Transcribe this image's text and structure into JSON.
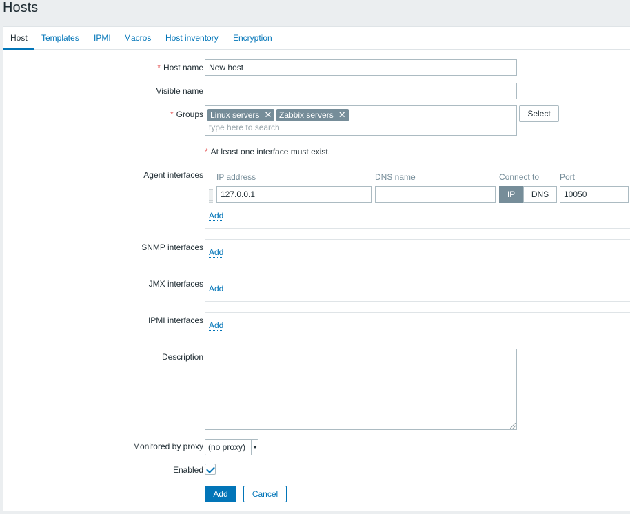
{
  "page": {
    "title": "Hosts"
  },
  "tabs": [
    {
      "label": "Host",
      "active": true
    },
    {
      "label": "Templates"
    },
    {
      "label": "IPMI"
    },
    {
      "label": "Macros"
    },
    {
      "label": "Host inventory"
    },
    {
      "label": "Encryption"
    }
  ],
  "form": {
    "host_name": {
      "label": "Host name",
      "value": "New host",
      "required": "*"
    },
    "visible_name": {
      "label": "Visible name",
      "value": ""
    },
    "groups": {
      "label": "Groups",
      "required": "*",
      "selected": [
        "Linux servers",
        "Zabbix servers"
      ],
      "remove_glyph": "✕",
      "placeholder": "type here to search",
      "select_button": "Select"
    },
    "interface_note": {
      "marker": "*",
      "text": "At least one interface must exist."
    },
    "agent_interfaces": {
      "label": "Agent interfaces",
      "columns": {
        "ip": "IP address",
        "dns": "DNS name",
        "connect": "Connect to",
        "port": "Port"
      },
      "row": {
        "ip": "127.0.0.1",
        "dns": "",
        "connect_ip": "IP",
        "connect_dns": "DNS",
        "port": "10050"
      },
      "add": "Add"
    },
    "snmp_interfaces": {
      "label": "SNMP interfaces",
      "add": "Add"
    },
    "jmx_interfaces": {
      "label": "JMX interfaces",
      "add": "Add"
    },
    "ipmi_interfaces": {
      "label": "IPMI interfaces",
      "add": "Add"
    },
    "description": {
      "label": "Description",
      "value": ""
    },
    "proxy": {
      "label": "Monitored by proxy",
      "value": "(no proxy)"
    },
    "enabled": {
      "label": "Enabled",
      "checked": true
    },
    "buttons": {
      "add": "Add",
      "cancel": "Cancel"
    }
  },
  "colors": {
    "accent": "#0275b8",
    "required": "#e45959",
    "chip_bg": "#768d99",
    "page_bg": "#ebeef0"
  }
}
